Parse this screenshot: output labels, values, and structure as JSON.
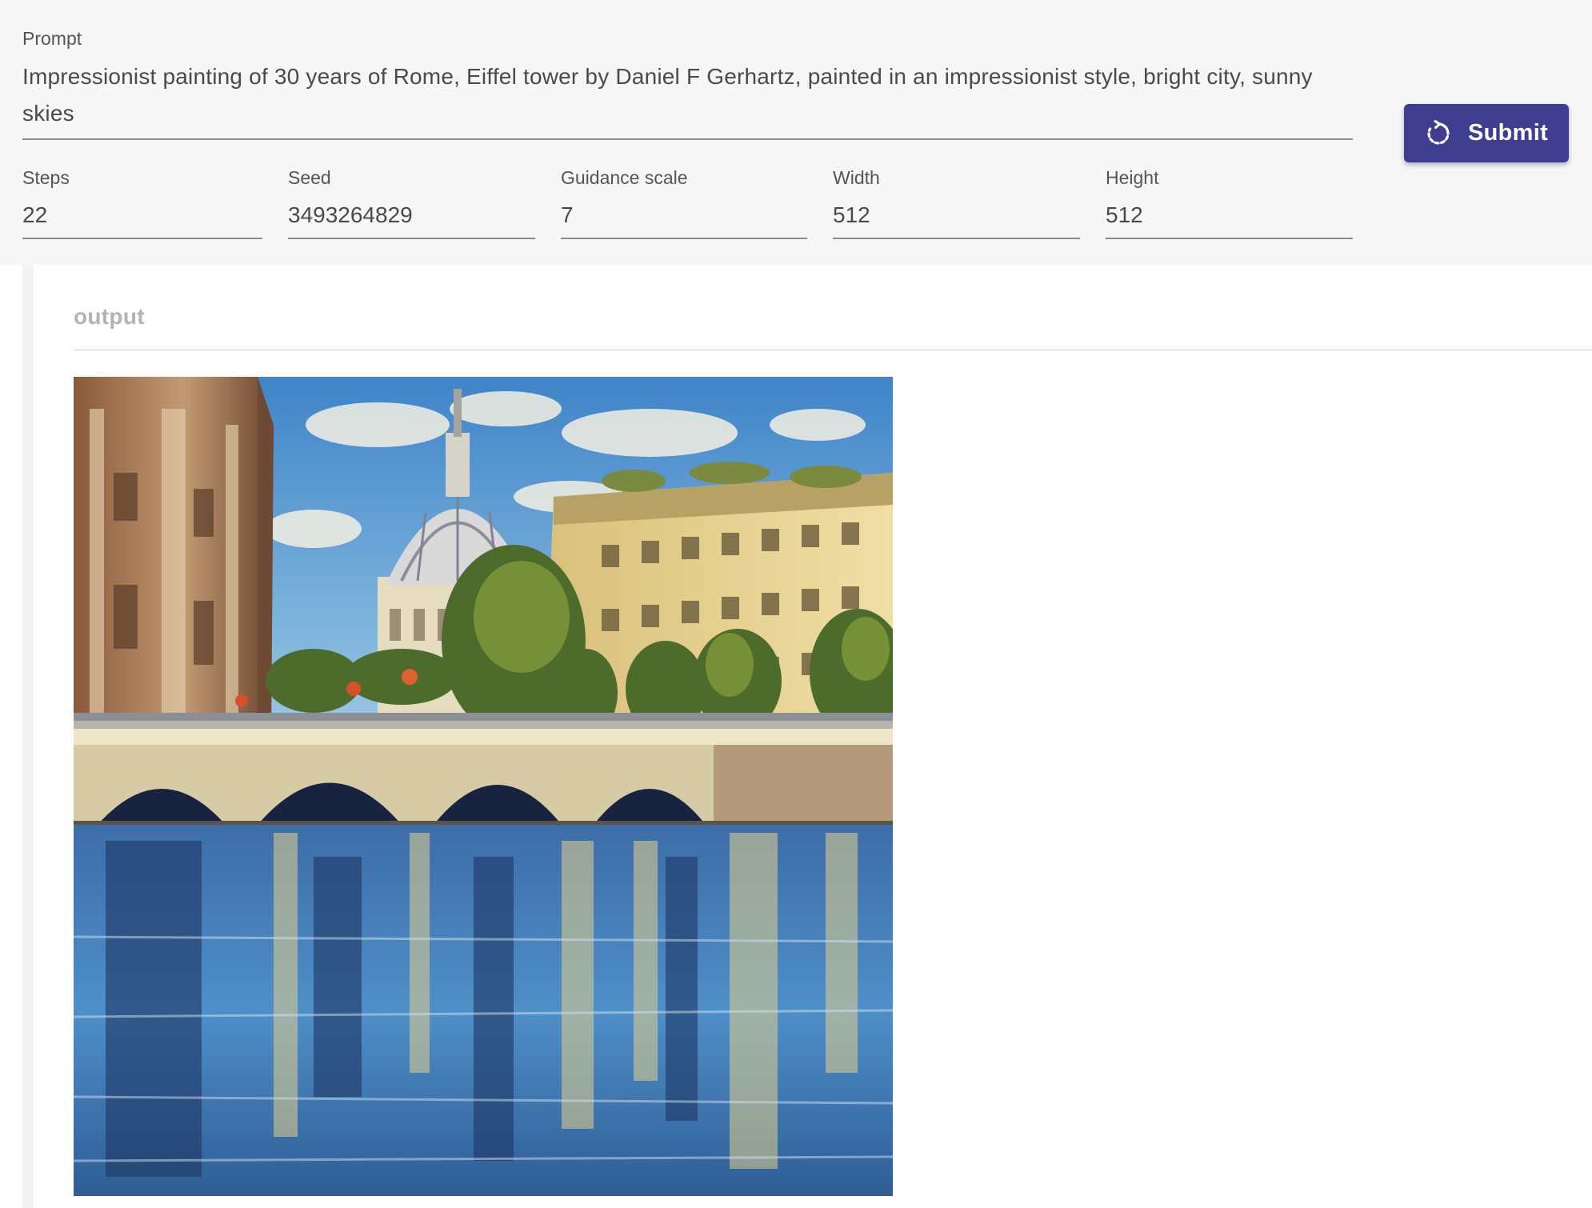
{
  "form": {
    "prompt": {
      "label": "Prompt",
      "value": "Impressionist painting of 30 years of Rome, Eiffel tower by Daniel F Gerhartz, painted in an impressionist style, bright city, sunny skies"
    },
    "steps": {
      "label": "Steps",
      "value": "22"
    },
    "seed": {
      "label": "Seed",
      "value": "3493264829"
    },
    "guidance_scale": {
      "label": "Guidance scale",
      "value": "7"
    },
    "width": {
      "label": "Width",
      "value": "512"
    },
    "height": {
      "label": "Height",
      "value": "512"
    },
    "submit_label": "Submit"
  },
  "output": {
    "label": "output",
    "image_description_icon": "generated-painting-image"
  },
  "colors": {
    "accent": "#3f3d8f",
    "panel_background": "#f6f6f6",
    "output_label": "#b3b3b3"
  }
}
